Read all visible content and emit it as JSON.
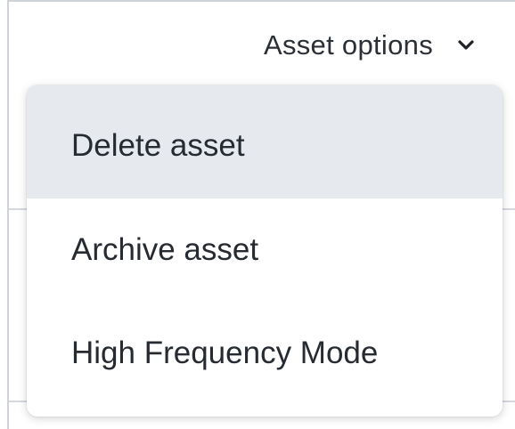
{
  "header": {
    "options_label": "Asset options",
    "options_icon": "chevron-down-icon"
  },
  "menu": {
    "items": [
      {
        "label": "Delete asset",
        "highlighted": true
      },
      {
        "label": "Archive asset",
        "highlighted": false
      },
      {
        "label": "High Frequency Mode",
        "highlighted": false
      }
    ]
  },
  "colors": {
    "text": "#262a31",
    "highlight": "#e6e9ee",
    "border": "#cfd3da"
  }
}
